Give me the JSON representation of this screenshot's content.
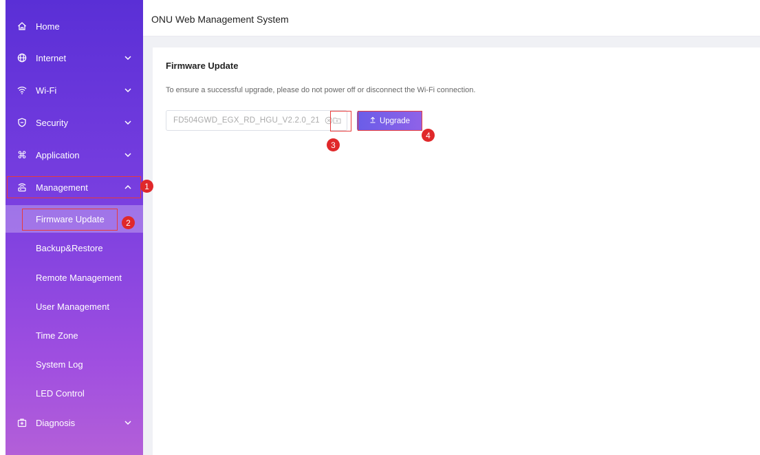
{
  "header": {
    "title": "ONU Web Management System"
  },
  "sidebar": {
    "items": [
      {
        "label": "Home",
        "icon": "home-icon"
      },
      {
        "label": "Internet",
        "icon": "globe-icon"
      },
      {
        "label": "Wi-Fi",
        "icon": "wifi-icon"
      },
      {
        "label": "Security",
        "icon": "shield-icon"
      },
      {
        "label": "Application",
        "icon": "command-icon"
      },
      {
        "label": "Management",
        "icon": "router-icon"
      },
      {
        "label": "Diagnosis",
        "icon": "medkit-icon"
      }
    ],
    "management_sub": [
      {
        "label": "Firmware Update",
        "active": true
      },
      {
        "label": "Backup&Restore"
      },
      {
        "label": "Remote Management"
      },
      {
        "label": "User Management"
      },
      {
        "label": "Time Zone"
      },
      {
        "label": "System Log"
      },
      {
        "label": "LED Control"
      }
    ]
  },
  "firmware": {
    "title": "Firmware Update",
    "note": "To ensure a successful upgrade, please do not power off or disconnect the Wi-Fi connection.",
    "filename": "FD504GWD_EGX_RD_HGU_V2.2.0_21",
    "upgrade_label": "Upgrade"
  },
  "annotations": {
    "step1": "1",
    "step2": "2",
    "step3": "3",
    "step4": "4"
  },
  "colors": {
    "sidebar_top": "#5a2fd6",
    "sidebar_bottom": "#b35fd8",
    "accent": "#7a5fe8",
    "annotation": "#e0282a"
  }
}
